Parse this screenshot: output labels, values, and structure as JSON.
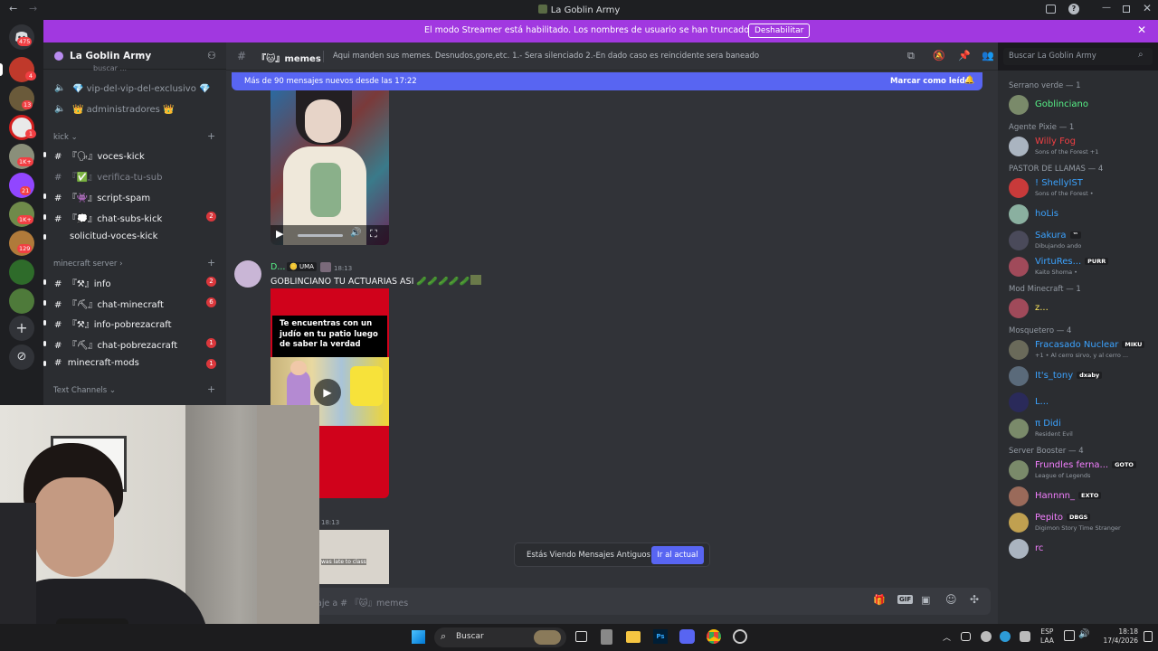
{
  "window": {
    "title": "La Goblin Army"
  },
  "banner": {
    "message": "El modo Streamer está habilitado. Los nombres de usuario se han truncado.",
    "disable_label": "Deshabilitar"
  },
  "rail": {
    "badges": [
      "475",
      "4",
      "13",
      "1",
      "1K+",
      "21",
      "1K+",
      "129"
    ]
  },
  "guild": {
    "name": "La Goblin Army",
    "channels_top": [
      "vip-del-vip-del-exclusivo",
      "administradores"
    ],
    "kick_category": "kick",
    "kick_channels": [
      {
        "name": "voces-kick",
        "badge": ""
      },
      {
        "name": "verifica-tu-sub",
        "badge": ""
      },
      {
        "name": "script-spam",
        "badge": ""
      },
      {
        "name": "chat-subs-kick",
        "badge": "2"
      },
      {
        "name": "solicitud-voces-kick",
        "badge": ""
      }
    ],
    "mc_category": "minecraft server",
    "mc_channels": [
      {
        "name": "info",
        "badge": "2"
      },
      {
        "name": "chat-minecraft",
        "badge": "6"
      },
      {
        "name": "info-pobrezacraft",
        "badge": ""
      },
      {
        "name": "chat-pobrezacraft",
        "badge": "1"
      },
      {
        "name": "minecraft-mods",
        "badge": "1"
      }
    ],
    "text_category": "Text Channels"
  },
  "chat": {
    "channel_name": "memes",
    "topic": "Aqui manden sus memes. Desnudos,gore,etc. 1.- Sera silenciado 2.-En dado caso es reincidente sera baneado",
    "search_placeholder": "Buscar La Goblin Army",
    "new_messages": "Más de 90 mensajes nuevos desde las 17:22",
    "mark_read": "Marcar como leído",
    "message": {
      "author": "D...",
      "role_tag": "UMA",
      "time": "18:13",
      "text": "GOBLINCIANO TU ACTUARIAS ASI"
    },
    "meme_caption": "Te encuentras con un judío en tu patio luego de saber la verdad",
    "second_time": "18:13",
    "clip_text": "was late to class",
    "old_notice": "Estás Viendo Mensajes Antiguos",
    "jump_label": "Ir al actual",
    "composer_placeholder": "aje a # 『🐱』memes"
  },
  "members": {
    "groups": [
      {
        "title": "Serrano verde — 1",
        "members": [
          {
            "name": "Goblinciano",
            "color": "#57f287",
            "sub": "",
            "tag": ""
          }
        ]
      },
      {
        "title": "Agente Pixie — 1",
        "members": [
          {
            "name": "Willy Fog",
            "color": "#f23f43",
            "sub": "Sons of the Forest +1",
            "tag": ""
          }
        ]
      },
      {
        "title": "PASTOR DE LLAMAS — 4",
        "members": [
          {
            "name": "! ShellyIST",
            "color": "#3ba3ff",
            "sub": "Sons of the Forest •",
            "tag": ""
          },
          {
            "name": "hoLis",
            "color": "#3ba3ff",
            "sub": "",
            "tag": ""
          },
          {
            "name": "Sakura",
            "color": "#3ba3ff",
            "sub": "Dibujando ando",
            "tag": "™"
          },
          {
            "name": "VirtuRes...",
            "color": "#3ba3ff",
            "sub": "Kaito Shoma •",
            "tag": "PURR"
          }
        ]
      },
      {
        "title": "Mod Minecraft — 1",
        "members": [
          {
            "name": "z...",
            "color": "#fee75c",
            "sub": "",
            "tag": ""
          }
        ]
      },
      {
        "title": "Mosquetero — 4",
        "members": [
          {
            "name": "Fracasado Nuclear",
            "color": "#3ba3ff",
            "sub": "+1 • Al cerro sirvo, y al cerro ...",
            "tag": "MIKU"
          },
          {
            "name": "It's_tony",
            "color": "#3ba3ff",
            "sub": "",
            "tag": "dxaby"
          },
          {
            "name": "L...",
            "color": "#3ba3ff",
            "sub": "",
            "tag": ""
          },
          {
            "name": "π Didi",
            "color": "#3ba3ff",
            "sub": "Resident Evil",
            "tag": ""
          }
        ]
      },
      {
        "title": "Server Booster — 4",
        "members": [
          {
            "name": "Frundles ferna...",
            "color": "#f47fff",
            "sub": "League of Legends",
            "tag": "GOTO"
          },
          {
            "name": "Hannnn_",
            "color": "#f47fff",
            "sub": "",
            "tag": "EXTO"
          },
          {
            "name": "Pepito",
            "color": "#f47fff",
            "sub": "Digimon Story Time Stranger",
            "tag": "DBGS"
          },
          {
            "name": "rc",
            "color": "#f47fff",
            "sub": "",
            "tag": ""
          }
        ]
      }
    ]
  },
  "taskbar": {
    "search": "Buscar",
    "lang": "ESP",
    "lang2": "LAA",
    "time": "18:18",
    "date": "17/4/2026"
  }
}
